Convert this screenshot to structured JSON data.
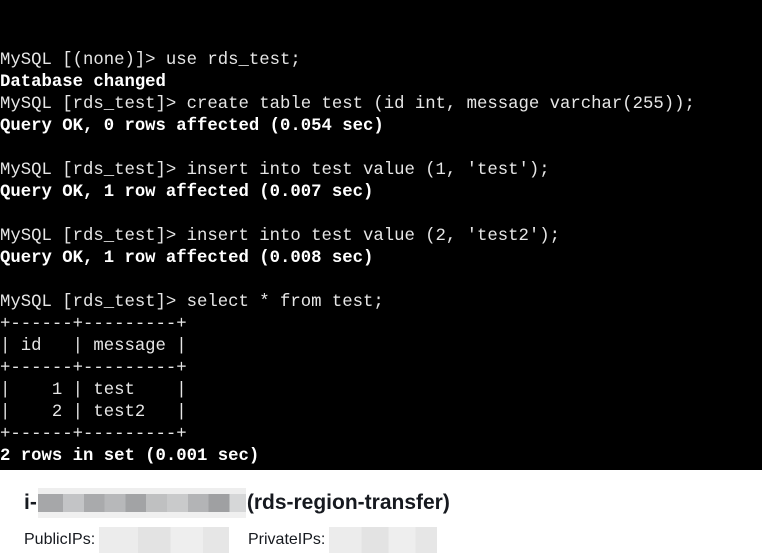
{
  "terminal": {
    "lines": [
      {
        "text": "MySQL [(none)]> use rds_test;",
        "type": "prompt"
      },
      {
        "text": "Database changed",
        "type": "output"
      },
      {
        "text": "MySQL [rds_test]> create table test (id int, message varchar(255));",
        "type": "prompt"
      },
      {
        "text": "Query OK, 0 rows affected (0.054 sec)",
        "type": "output"
      },
      {
        "text": "",
        "type": "blank"
      },
      {
        "text": "MySQL [rds_test]> insert into test value (1, 'test');",
        "type": "prompt"
      },
      {
        "text": "Query OK, 1 row affected (0.007 sec)",
        "type": "output"
      },
      {
        "text": "",
        "type": "blank"
      },
      {
        "text": "MySQL [rds_test]> insert into test value (2, 'test2');",
        "type": "prompt"
      },
      {
        "text": "Query OK, 1 row affected (0.008 sec)",
        "type": "output"
      },
      {
        "text": "",
        "type": "blank"
      },
      {
        "text": "MySQL [rds_test]> select * from test;",
        "type": "prompt"
      },
      {
        "text": "+------+---------+",
        "type": "table"
      },
      {
        "text": "| id   | message |",
        "type": "table"
      },
      {
        "text": "+------+---------+",
        "type": "table"
      },
      {
        "text": "|    1 | test    |",
        "type": "table"
      },
      {
        "text": "|    2 | test2   |",
        "type": "table"
      },
      {
        "text": "+------+---------+",
        "type": "table"
      },
      {
        "text": "2 rows in set (0.001 sec)",
        "type": "output"
      },
      {
        "text": "",
        "type": "blank"
      }
    ],
    "current_prompt": "MySQL [rds_test]> "
  },
  "instance": {
    "id_prefix": "i-",
    "name": "(rds-region-transfer)",
    "public_ips_label": "PublicIPs:",
    "private_ips_label": "PrivateIPs:"
  }
}
